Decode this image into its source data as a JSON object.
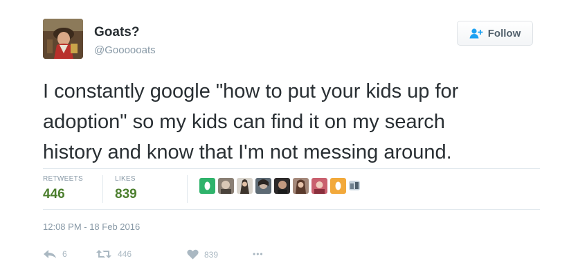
{
  "user": {
    "name": "Goats?",
    "handle": "@Goooooats"
  },
  "follow_button": {
    "label": "Follow",
    "icon": "add-user-icon"
  },
  "tweet": {
    "text": "I constantly google \"how to put your kids up for\nadoption\" so my kids can find it on my search\nhistory and know that I'm not messing around."
  },
  "stats": {
    "retweets_label": "RETWEETS",
    "retweets": "446",
    "likes_label": "LIKES",
    "likes": "839"
  },
  "timestamp": "12:08 PM - 18 Feb 2016",
  "actions": {
    "reply_count": "6",
    "retweet_count": "446",
    "like_count": "839",
    "more_label": "•••"
  },
  "colors": {
    "stat_green": "#4c7f2e",
    "muted": "#8899a6",
    "text": "#292f33"
  }
}
